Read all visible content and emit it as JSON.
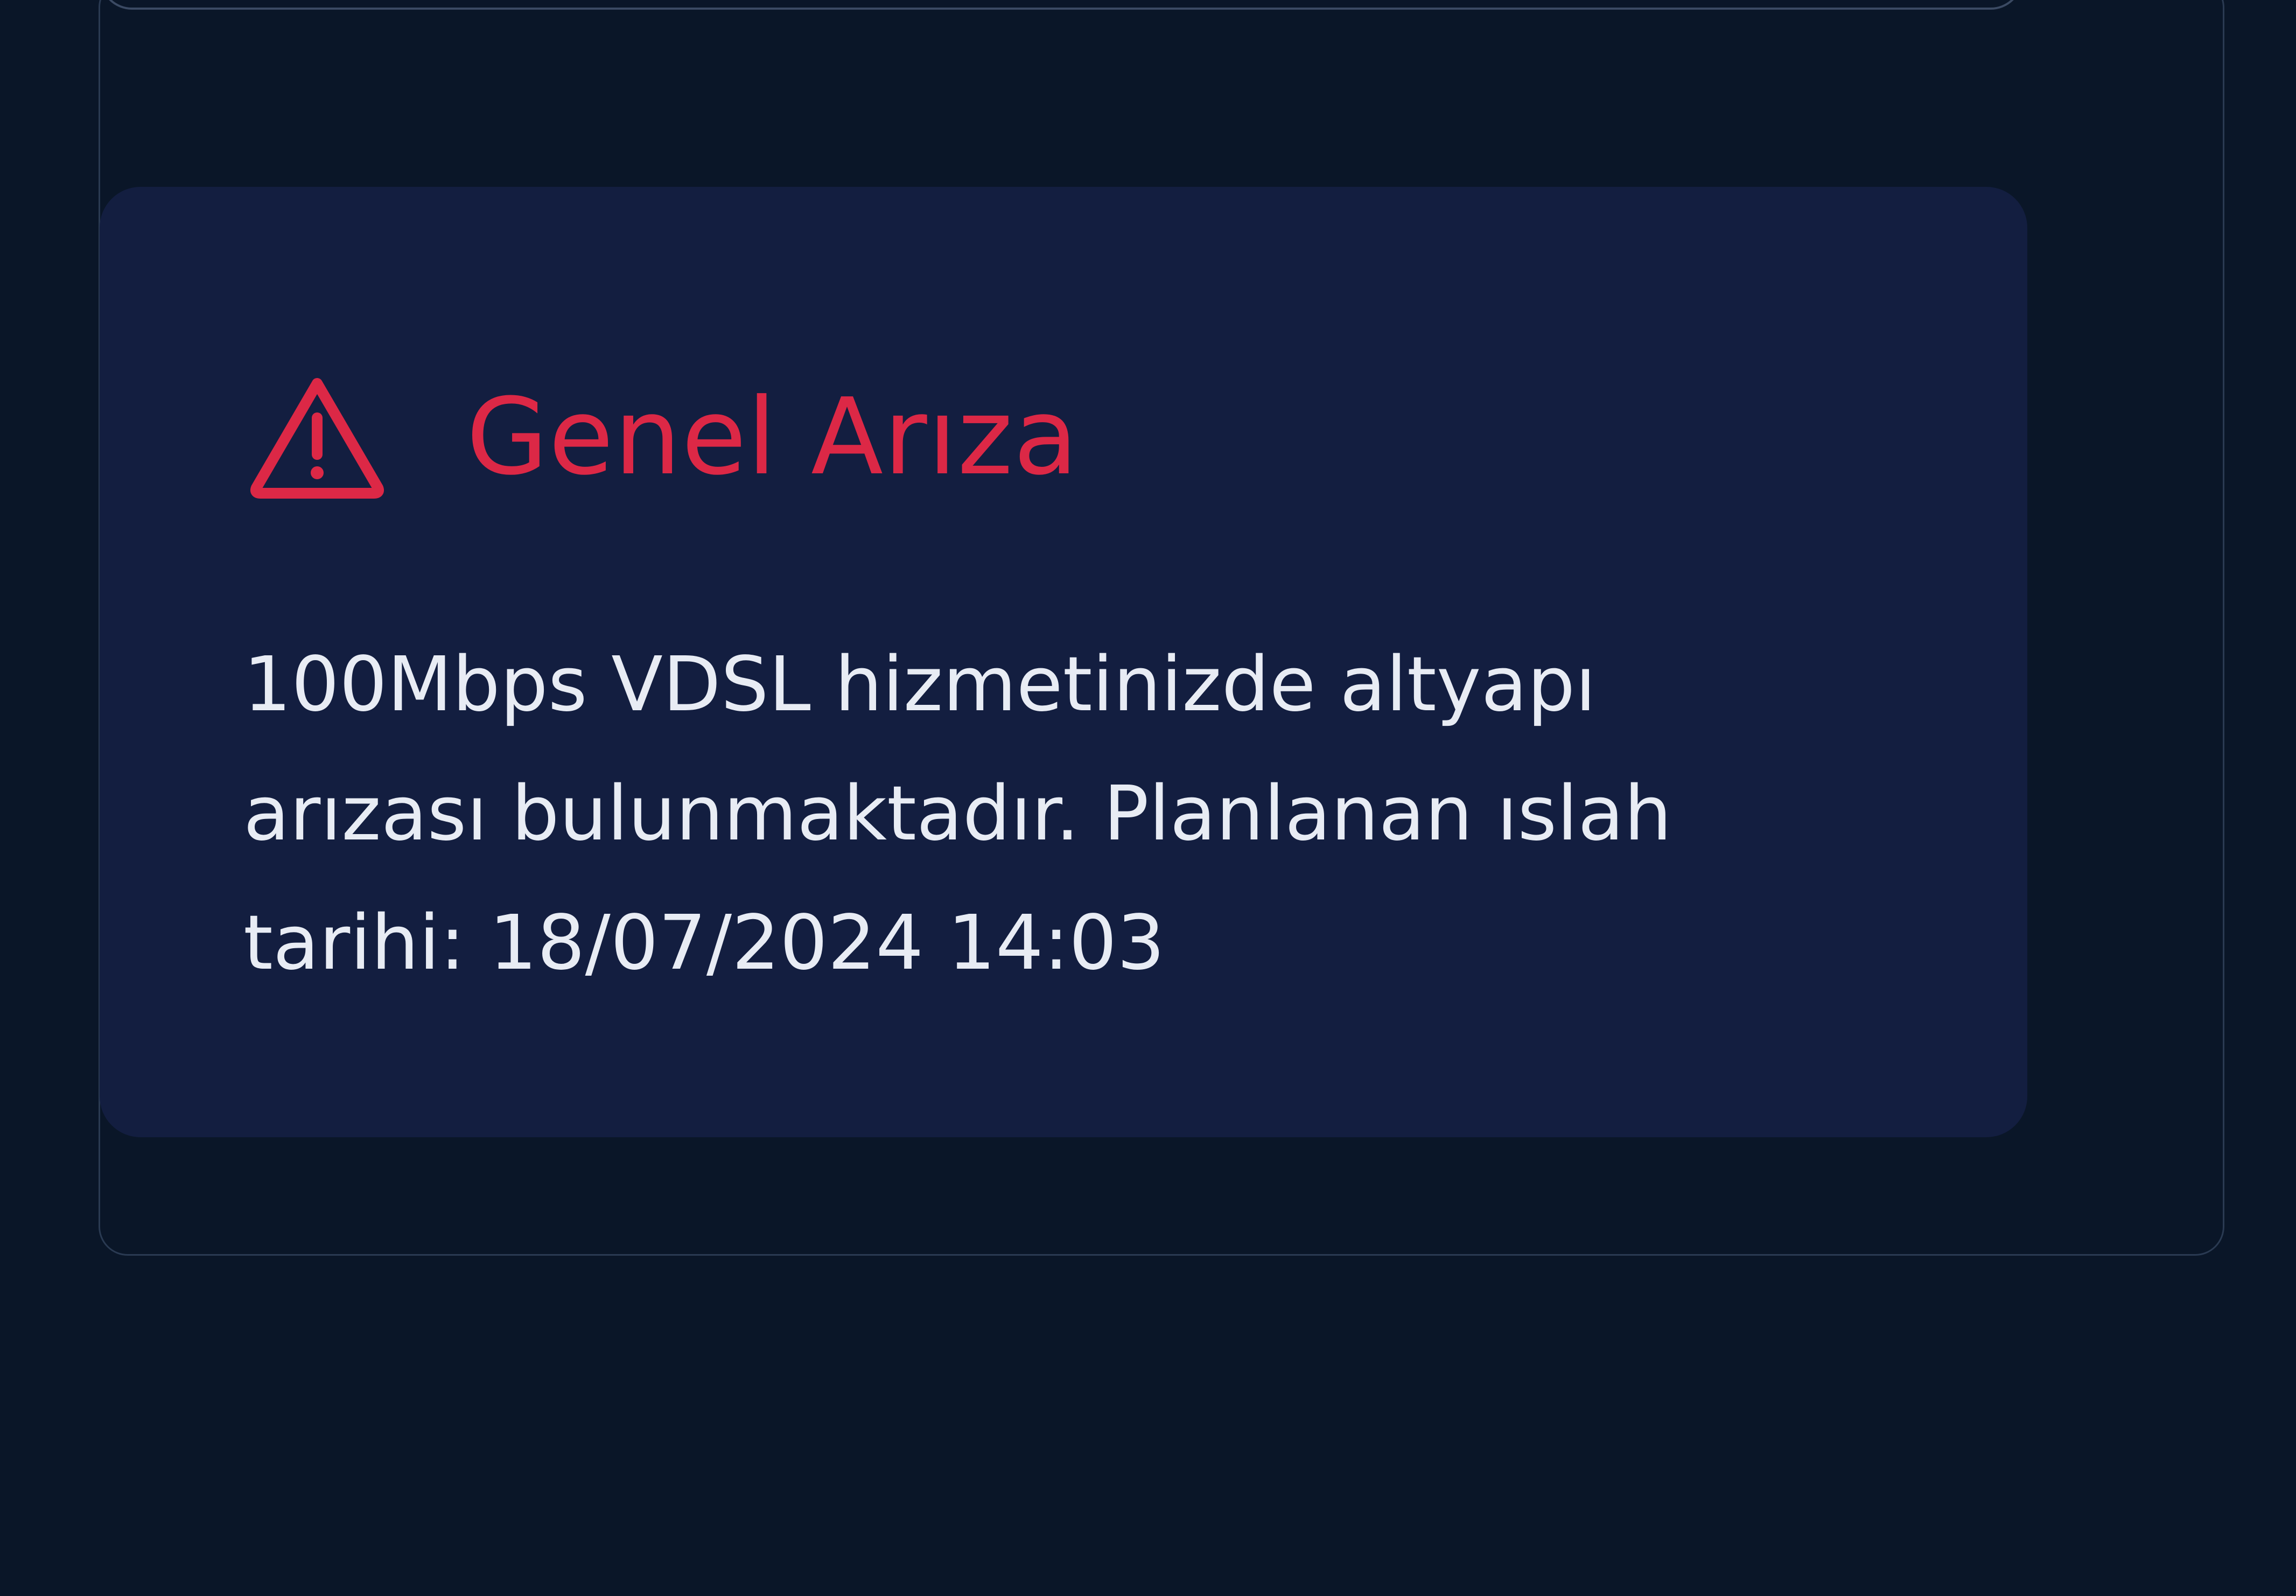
{
  "alert": {
    "icon": "warning-triangle-icon",
    "title": "Genel Arıza",
    "message": "100Mbps VDSL hizmetinizde altyapı arızası bulunmaktadır. Planlanan ıslah tarihi: 18/07/2024 14:03"
  },
  "colors": {
    "background": "#0a1628",
    "card_background": "#131e40",
    "alert_red": "#dc2846",
    "text": "#e8ecf4",
    "border": "#2a3a52"
  }
}
